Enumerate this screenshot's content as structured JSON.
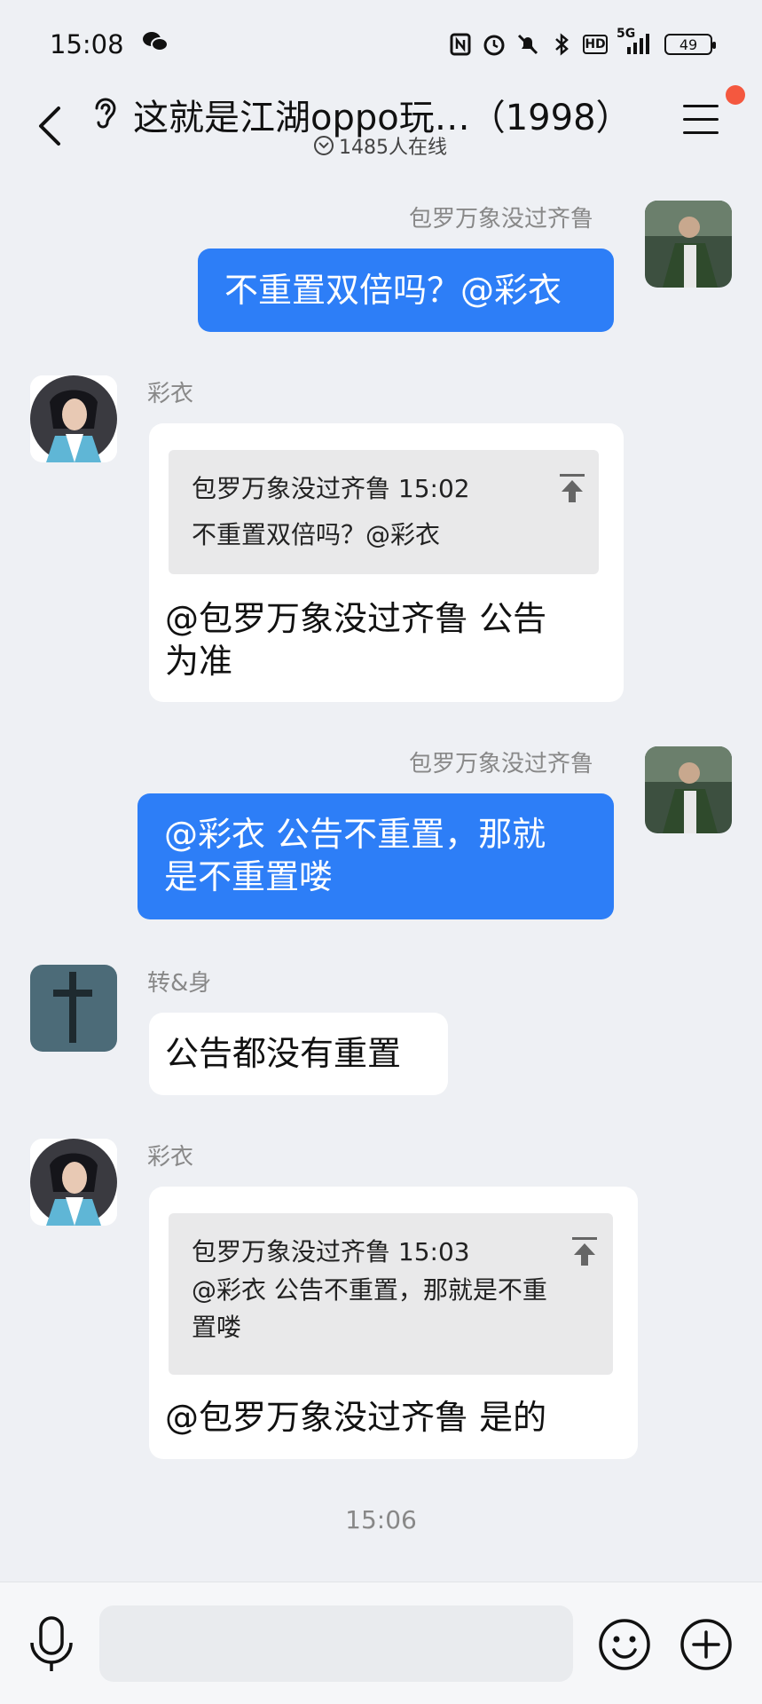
{
  "status_bar": {
    "time": "15:08",
    "battery": "49",
    "signal": "5G",
    "icons": [
      "wechat-icon",
      "nfc-icon",
      "alarm-icon",
      "mute-icon",
      "bluetooth-icon",
      "hd-icon",
      "signal-icon",
      "battery-icon"
    ]
  },
  "header": {
    "title": "这就是江湖oppo玩…（1998）",
    "online": "1485人在线",
    "colors": {
      "notification_dot": "#f4583f"
    }
  },
  "messages": [
    {
      "type": "outgoing",
      "sender": "包罗万象没过齐鲁",
      "text": "不重置双倍吗？@彩衣"
    },
    {
      "type": "incoming",
      "sender": "彩衣",
      "quote": {
        "head": "包罗万象没过齐鲁 15:02",
        "body": "不重置双倍吗？@彩衣"
      },
      "text_lines": [
        "@包罗万象没过齐鲁 公告",
        "为准"
      ]
    },
    {
      "type": "outgoing",
      "sender": "包罗万象没过齐鲁",
      "text_lines": [
        "@彩衣 公告不重置，那就",
        "是不重置喽"
      ]
    },
    {
      "type": "incoming",
      "sender": "转&身",
      "text": "公告都没有重置"
    },
    {
      "type": "incoming",
      "sender": "彩衣",
      "quote": {
        "head": "包罗万象没过齐鲁 15:03",
        "body_lines": [
          "@彩衣 公告不重置，那就是不重",
          "置喽"
        ]
      },
      "text": "@包罗万象没过齐鲁 是的"
    }
  ],
  "timestamp": "15:06",
  "input_bar": {
    "placeholder": ""
  },
  "colors": {
    "bubble_outgoing": "#2d7ef7",
    "chat_bg": "#eef0f4"
  }
}
